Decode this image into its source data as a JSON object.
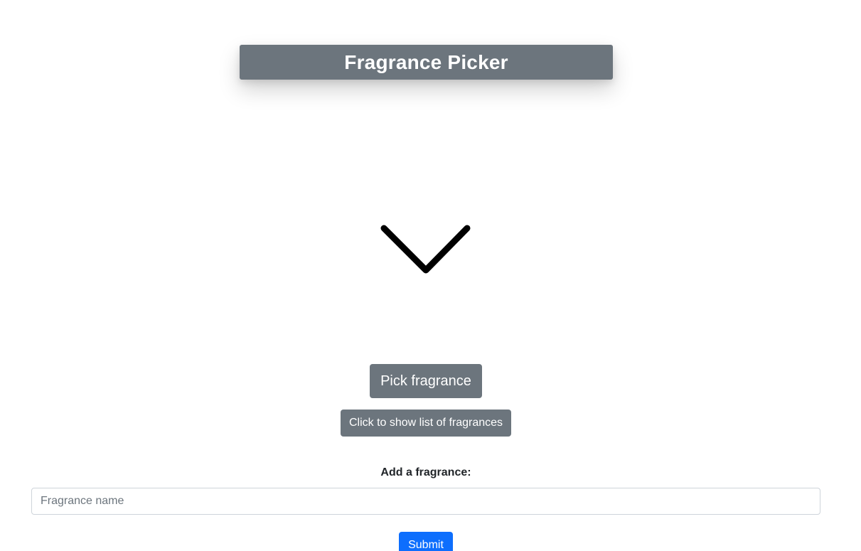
{
  "header": {
    "title": "Fragrance Picker"
  },
  "display": {
    "icon": "chevron-down-icon"
  },
  "actions": {
    "pick_label": "Pick fragrance",
    "show_list_label": "Click to show list of fragrances"
  },
  "add_form": {
    "label": "Add a fragrance:",
    "input_value": "",
    "input_placeholder": "Fragrance name",
    "submit_label": "Submit"
  },
  "colors": {
    "secondary": "#6c757d",
    "primary": "#0d6efd"
  }
}
